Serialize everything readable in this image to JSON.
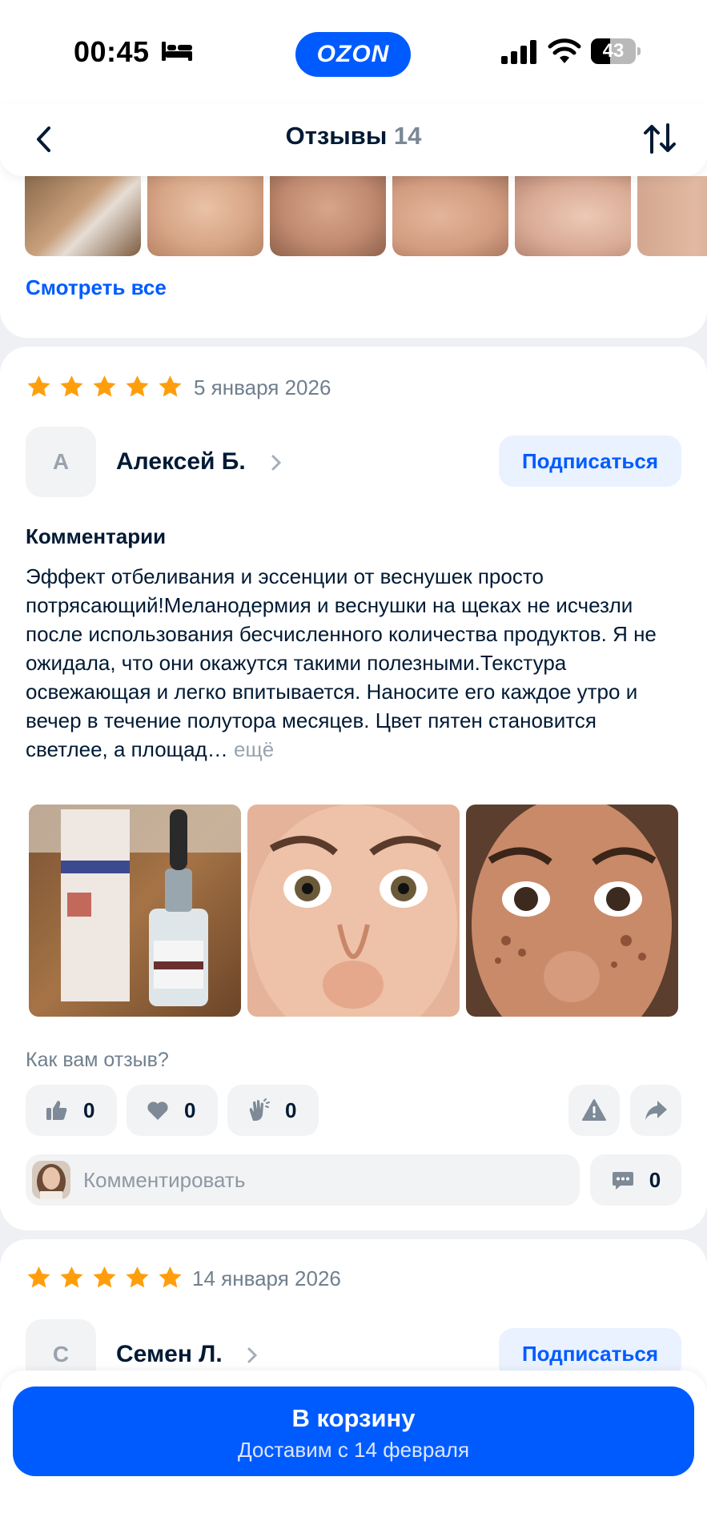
{
  "status_bar": {
    "time": "00:45",
    "battery_percent": 43,
    "battery_label": "43",
    "logo": "OZON"
  },
  "header": {
    "title": "Отзывы",
    "count": "14"
  },
  "gallery": {
    "see_all_label": "Смотреть все"
  },
  "reviews": [
    {
      "rating": 5,
      "date": "5 января 2026",
      "avatar_letter": "А",
      "author": "Алексей Б.",
      "subscribe_label": "Подписаться",
      "section_label": "Комментарии",
      "text": "Эффект отбеливания и эссенции от веснушек просто потрясающий!Меланодермия и веснушки на щеках не исчезли после использования бесчисленного количества продуктов. Я не ожидала, что они окажутся такими полезными.Текстура освежающая и легко впитывается. Наносите его каждое утро и вечер в течение полутора месяцев. Цвет пятен становится светлее, а площад…",
      "more_label": "ещё",
      "question": "Как вам отзыв?",
      "likes": "0",
      "hearts": "0",
      "claps": "0",
      "comment_placeholder": "Комментировать",
      "comments": "0"
    },
    {
      "rating": 5,
      "date": "14 января 2026",
      "avatar_letter": "С",
      "author": "Семен Л.",
      "subscribe_label": "Подписаться"
    }
  ],
  "cart": {
    "title": "В корзину",
    "subtitle": "Доставим с 14 февраля"
  },
  "colors": {
    "brand": "#005bff",
    "star": "#ff9e0d",
    "background": "#eef0f4"
  }
}
